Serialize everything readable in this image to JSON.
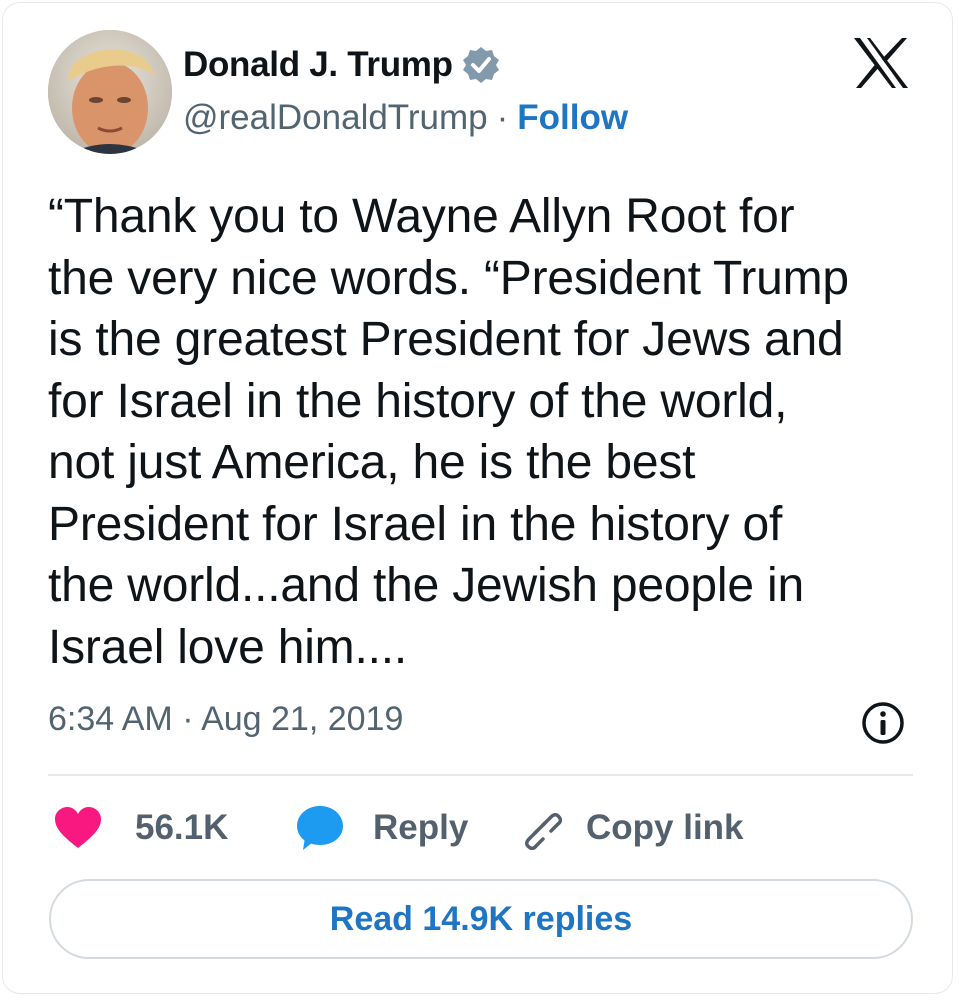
{
  "author": {
    "name": "Donald J. Trump",
    "handle": "@realDonaldTrump",
    "separator": "·",
    "follow_label": "Follow",
    "verified": true,
    "avatar_icon": "avatar-photo"
  },
  "brand_icon": "x-logo-icon",
  "tweet": {
    "text": "“Thank you to Wayne Allyn Root for\nthe very nice words. “President Trump\nis the greatest President for Jews and\nfor Israel in the history of the world,\nnot just America, he is the best\nPresident for Israel in the history of\nthe world...and the Jewish people in\nIsrael love him....",
    "timestamp": "6:34 AM · Aug 21, 2019"
  },
  "actions": {
    "like_count": "56.1K",
    "reply_label": "Reply",
    "copy_link_label": "Copy link"
  },
  "footer": {
    "read_replies_label": "Read 14.9K replies"
  },
  "colors": {
    "like": "#f91880",
    "reply": "#1d9bf0",
    "link": "#1d75c4",
    "verified": "#829aab",
    "muted": "#536471"
  }
}
